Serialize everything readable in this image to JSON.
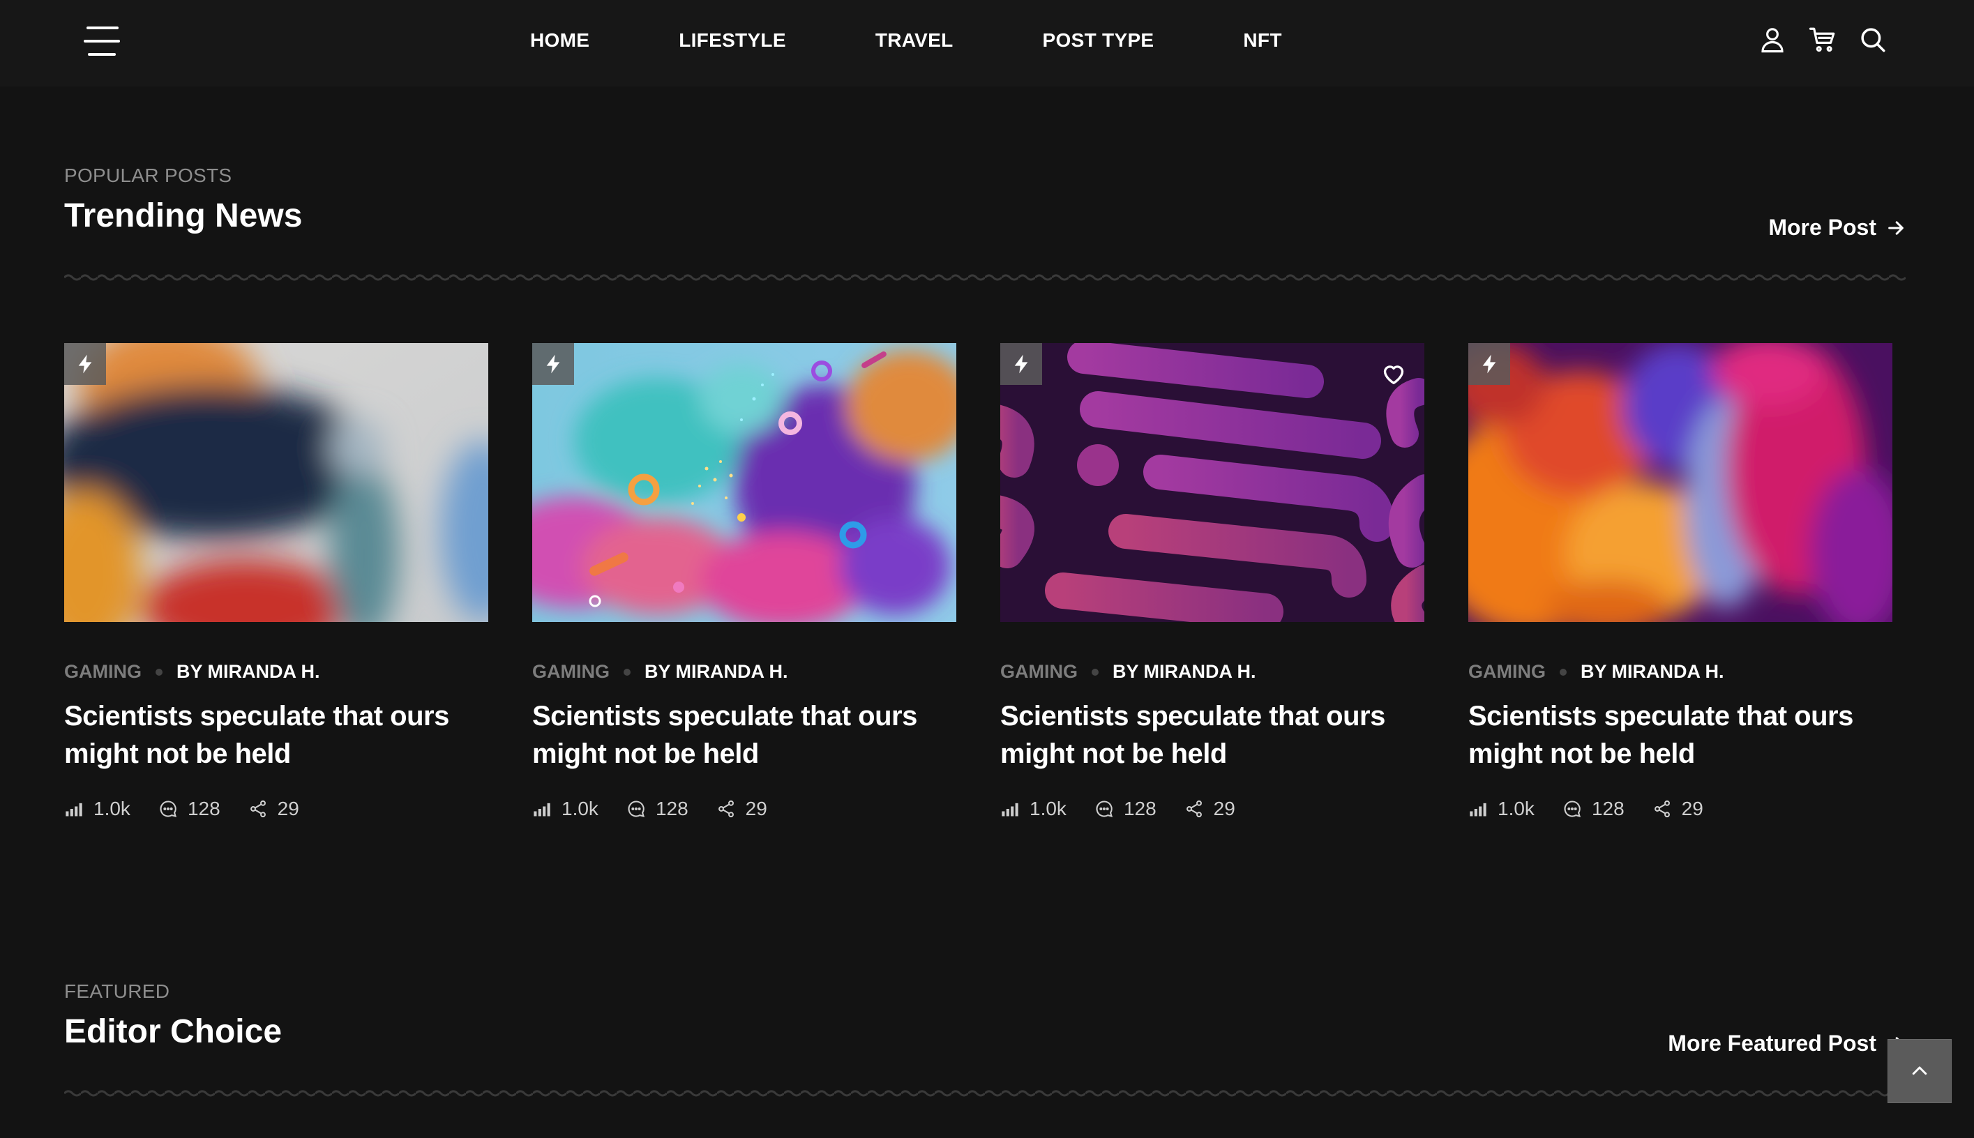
{
  "nav": {
    "links": [
      "HOME",
      "LIFESTYLE",
      "TRAVEL",
      "POST TYPE",
      "NFT"
    ],
    "icons": [
      "menu-icon",
      "user-icon",
      "cart-icon",
      "search-icon"
    ]
  },
  "trending": {
    "label": "POPULAR POSTS",
    "title": "Trending News",
    "more": "More Post"
  },
  "posts": [
    {
      "category": "GAMING",
      "author": "BY MIRANDA H.",
      "title": "Scientists speculate that ours might not be held",
      "views": "1.0k",
      "comments": "128",
      "shares": "29",
      "liked": false
    },
    {
      "category": "GAMING",
      "author": "BY MIRANDA H.",
      "title": "Scientists speculate that ours might not be held",
      "views": "1.0k",
      "comments": "128",
      "shares": "29",
      "liked": false
    },
    {
      "category": "GAMING",
      "author": "BY MIRANDA H.",
      "title": "Scientists speculate that ours might not be held",
      "views": "1.0k",
      "comments": "128",
      "shares": "29",
      "liked": true
    },
    {
      "category": "GAMING",
      "author": "BY MIRANDA H.",
      "title": "Scientists speculate that ours might not be held",
      "views": "1.0k",
      "comments": "128",
      "shares": "29",
      "liked": false
    }
  ],
  "featured": {
    "label": "FEATURED",
    "title": "Editor Choice",
    "more": "More Featured Post"
  },
  "colors": {
    "background": "#131313",
    "navbar": "#171717",
    "muted": "#8e8e8e"
  }
}
